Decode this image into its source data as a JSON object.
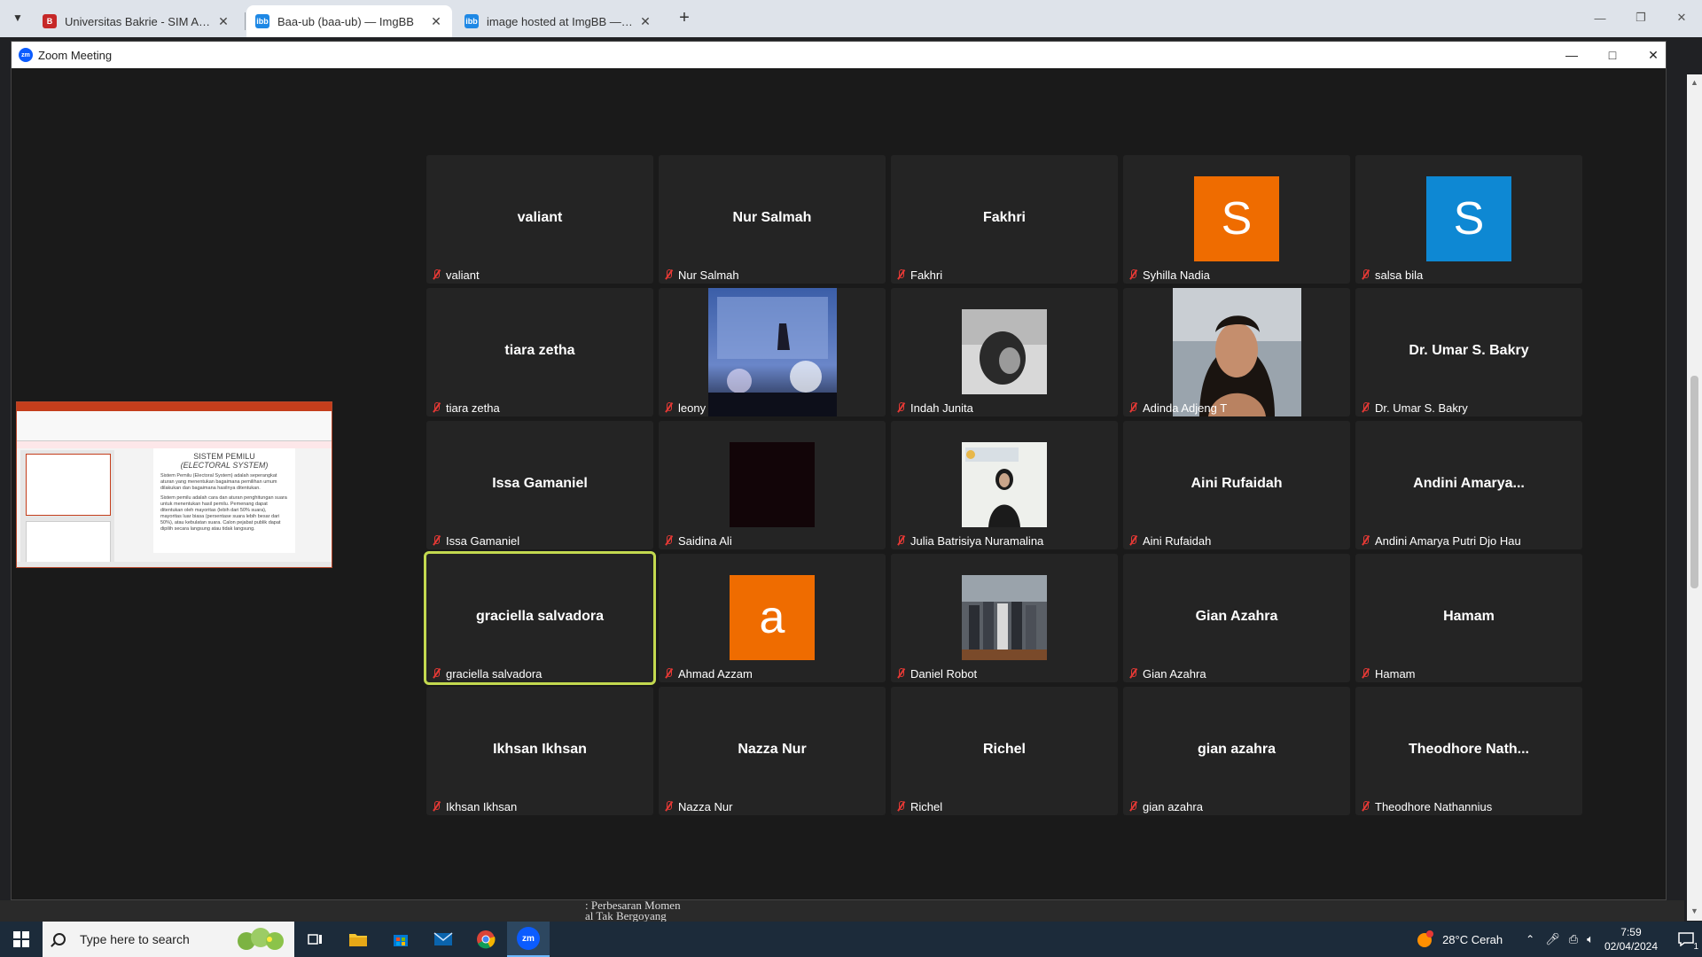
{
  "browser": {
    "tabs": [
      {
        "title": "Universitas Bakrie - SIM Akademik",
        "icon": "bakrie-favicon",
        "active": false
      },
      {
        "title": "Baa-ub (baa-ub) — ImgBB",
        "icon": "imgbb-favicon",
        "active": true
      },
      {
        "title": "image hosted at ImgBB — ImgBB",
        "icon": "imgbb-favicon",
        "active": false
      }
    ],
    "new_tab_symbol": "+"
  },
  "zoom": {
    "window_title": "Zoom Meeting",
    "logo_text": "zm"
  },
  "shared_slide": {
    "title_line1": "SISTEM PEMILU",
    "title_line2": "(ELECTORAL SYSTEM)",
    "bullet1": "Sistem Pemilu (Electoral System) adalah seperangkat aturan yang menentukan bagaimana pemilihan umum dilakukan dan bagaimana hasilnya ditentukan.",
    "bullet2": "Sistem pemilu adalah cara dan aturan penghitungan suara untuk menentukan hasil pemilu. Pemenang dapat ditentukan oleh mayoritas (lebih dari 50% suara), mayoritas luar biasa (persentase suara lebih besar dari 50%), atau kebulatan suara. Calon pejabat publik dapat dipilih secara langsung atau tidak langsung."
  },
  "participants": [
    {
      "name": "valiant",
      "label": "valiant",
      "type": "name"
    },
    {
      "name": "Nur Salmah",
      "label": "Nur Salmah",
      "type": "name"
    },
    {
      "name": "Fakhri",
      "label": "Fakhri",
      "type": "name"
    },
    {
      "name": "S",
      "label": "Syhilla Nadia",
      "type": "avatar",
      "color": "#ef6c00"
    },
    {
      "name": "S",
      "label": "salsa bila",
      "type": "avatar",
      "color": "#0e88d3"
    },
    {
      "name": "tiara zetha",
      "label": "tiara zetha",
      "type": "name"
    },
    {
      "name": "",
      "label": "leony",
      "type": "photo",
      "photo": "stage-photo"
    },
    {
      "name": "",
      "label": "Indah Junita",
      "type": "photo",
      "photo": "portrait-gray"
    },
    {
      "name": "",
      "label": "Adinda Adjeng T",
      "type": "photo",
      "photo": "portrait-woman"
    },
    {
      "name": "Dr. Umar S. Bakry",
      "label": "Dr. Umar S. Bakry",
      "type": "name"
    },
    {
      "name": "Issa Gamaniel",
      "label": "Issa Gamaniel",
      "type": "name"
    },
    {
      "name": "",
      "label": "Saidina Ali",
      "type": "photo",
      "photo": "dark-square"
    },
    {
      "name": "",
      "label": "Julia Batrisiya Nuramalina",
      "type": "photo",
      "photo": "event-portrait"
    },
    {
      "name": "Aini Rufaidah",
      "label": "Aini Rufaidah",
      "type": "name"
    },
    {
      "name": "Andini  Amarya...",
      "label": "Andini Amarya Putri Djo Hau",
      "type": "name"
    },
    {
      "name": "graciella salvadora",
      "label": "graciella salvadora",
      "type": "name",
      "speaking": true
    },
    {
      "name": "a",
      "label": "Ahmad Azzam",
      "type": "avatar",
      "color": "#ef6c00"
    },
    {
      "name": "",
      "label": "Daniel Robot",
      "type": "photo",
      "photo": "group-photo"
    },
    {
      "name": "Gian Azahra",
      "label": "Gian Azahra",
      "type": "name"
    },
    {
      "name": "Hamam",
      "label": "Hamam",
      "type": "name"
    },
    {
      "name": "Ikhsan Ikhsan",
      "label": "Ikhsan Ikhsan",
      "type": "name"
    },
    {
      "name": "Nazza Nur",
      "label": "Nazza Nur",
      "type": "name"
    },
    {
      "name": "Richel",
      "label": "Richel",
      "type": "name"
    },
    {
      "name": "gian azahra",
      "label": "gian azahra",
      "type": "name"
    },
    {
      "name": "Theodhore  Nath...",
      "label": "Theodhore Nathannius",
      "type": "name"
    }
  ],
  "background_peek": {
    "line1": ": Perbesaran Momen",
    "line2": "al Tak Bergoyang"
  },
  "taskbar": {
    "search_placeholder": "Type here to search",
    "weather": "28°C  Cerah",
    "time": "7:59",
    "date": "02/04/2024",
    "notification_count": "1"
  }
}
